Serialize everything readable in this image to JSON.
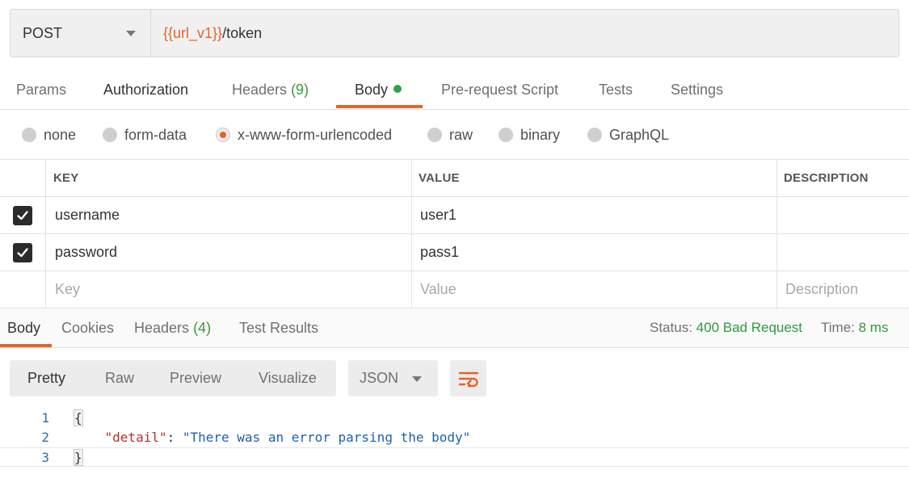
{
  "request": {
    "method": "POST",
    "url_variable": "{{url_v1}}",
    "url_path": "/token"
  },
  "request_tabs": {
    "params": "Params",
    "authorization": "Authorization",
    "headers": "Headers",
    "headers_count": "(9)",
    "body": "Body",
    "pre_request": "Pre-request Script",
    "tests": "Tests",
    "settings": "Settings"
  },
  "body_types": {
    "none": "none",
    "form_data": "form-data",
    "urlencoded": "x-www-form-urlencoded",
    "raw": "raw",
    "binary": "binary",
    "graphql": "GraphQL",
    "selected": "x-www-form-urlencoded"
  },
  "kv_table": {
    "columns": [
      "KEY",
      "VALUE",
      "DESCRIPTION"
    ],
    "rows": [
      {
        "checked": true,
        "key": "username",
        "value": "user1",
        "description": ""
      },
      {
        "checked": true,
        "key": "password",
        "value": "pass1",
        "description": ""
      }
    ],
    "placeholders": {
      "key": "Key",
      "value": "Value",
      "description": "Description"
    }
  },
  "response_tabs": {
    "body": "Body",
    "cookies": "Cookies",
    "headers": "Headers",
    "headers_count": "(4)",
    "test_results": "Test Results"
  },
  "response_status": {
    "status_label": "Status:",
    "status_value": "400 Bad Request",
    "time_label": "Time:",
    "time_value": "8 ms"
  },
  "response_toolbar": {
    "pretty": "Pretty",
    "raw": "Raw",
    "preview": "Preview",
    "visualize": "Visualize",
    "format": "JSON",
    "wrap_icon": "wrap-lines-icon"
  },
  "response_body": {
    "line_numbers": [
      "1",
      "2",
      "3"
    ],
    "open_brace": "{",
    "key": "\"detail\"",
    "colon": ": ",
    "value": "\"There was an error parsing the body\"",
    "close_brace": "}"
  },
  "colors": {
    "accent": "#e8622a",
    "status_ok": "#2f9a3f",
    "dot": "#28a745"
  }
}
